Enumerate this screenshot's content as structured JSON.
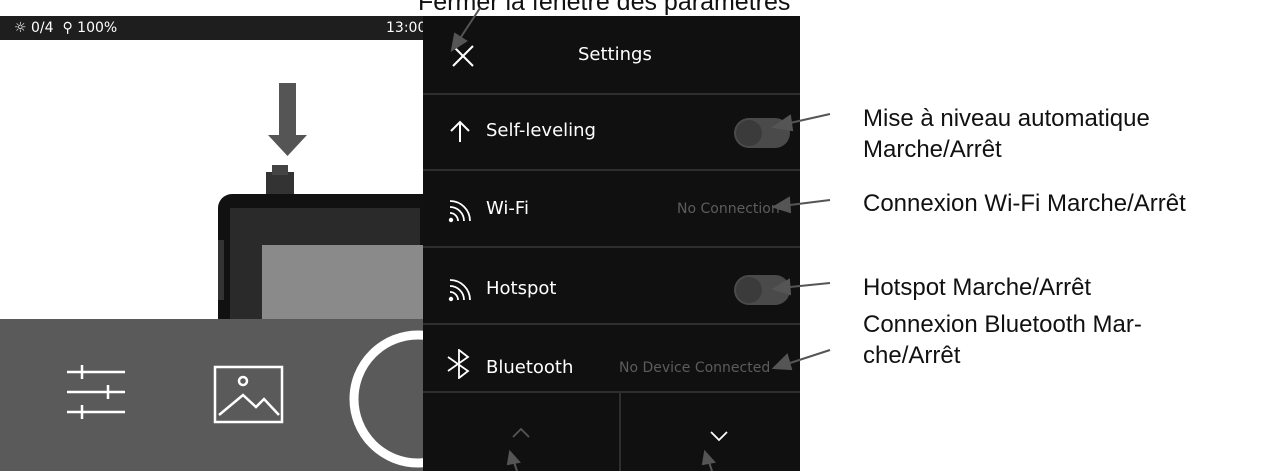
{
  "top_caption": "Fermer la fenêtre des paramètres",
  "status_bar": {
    "brightness": "0/4",
    "zoom": "100%",
    "time": "13:00"
  },
  "settings": {
    "title": "Settings",
    "close_icon": "close-icon",
    "rows": [
      {
        "icon": "arrow-up-icon",
        "label": "Self-leveling",
        "control": "toggle",
        "state": "off"
      },
      {
        "icon": "wifi-icon",
        "label": "Wi-Fi",
        "status": "No Connection"
      },
      {
        "icon": "wifi-icon",
        "label": "Hotspot",
        "control": "toggle",
        "state": "off"
      },
      {
        "icon": "bluetooth-icon",
        "label": "Bluetooth",
        "status": "No Device Connected"
      }
    ],
    "nav": [
      "chevron-up-icon",
      "chevron-down-icon"
    ]
  },
  "annotations": [
    {
      "text": "Mise à niveau automatique\nMarche/Arrêt"
    },
    {
      "text": "Connexion Wi-Fi Marche/Arrêt"
    },
    {
      "text": "Hotspot Marche/Arrêt"
    },
    {
      "text": "Connexion Bluetooth Mar-\nche/Arrêt"
    }
  ],
  "colors": {
    "panel_bg": "#101010",
    "toolbar_bg": "#5a5a5a",
    "arrow": "#555555"
  }
}
